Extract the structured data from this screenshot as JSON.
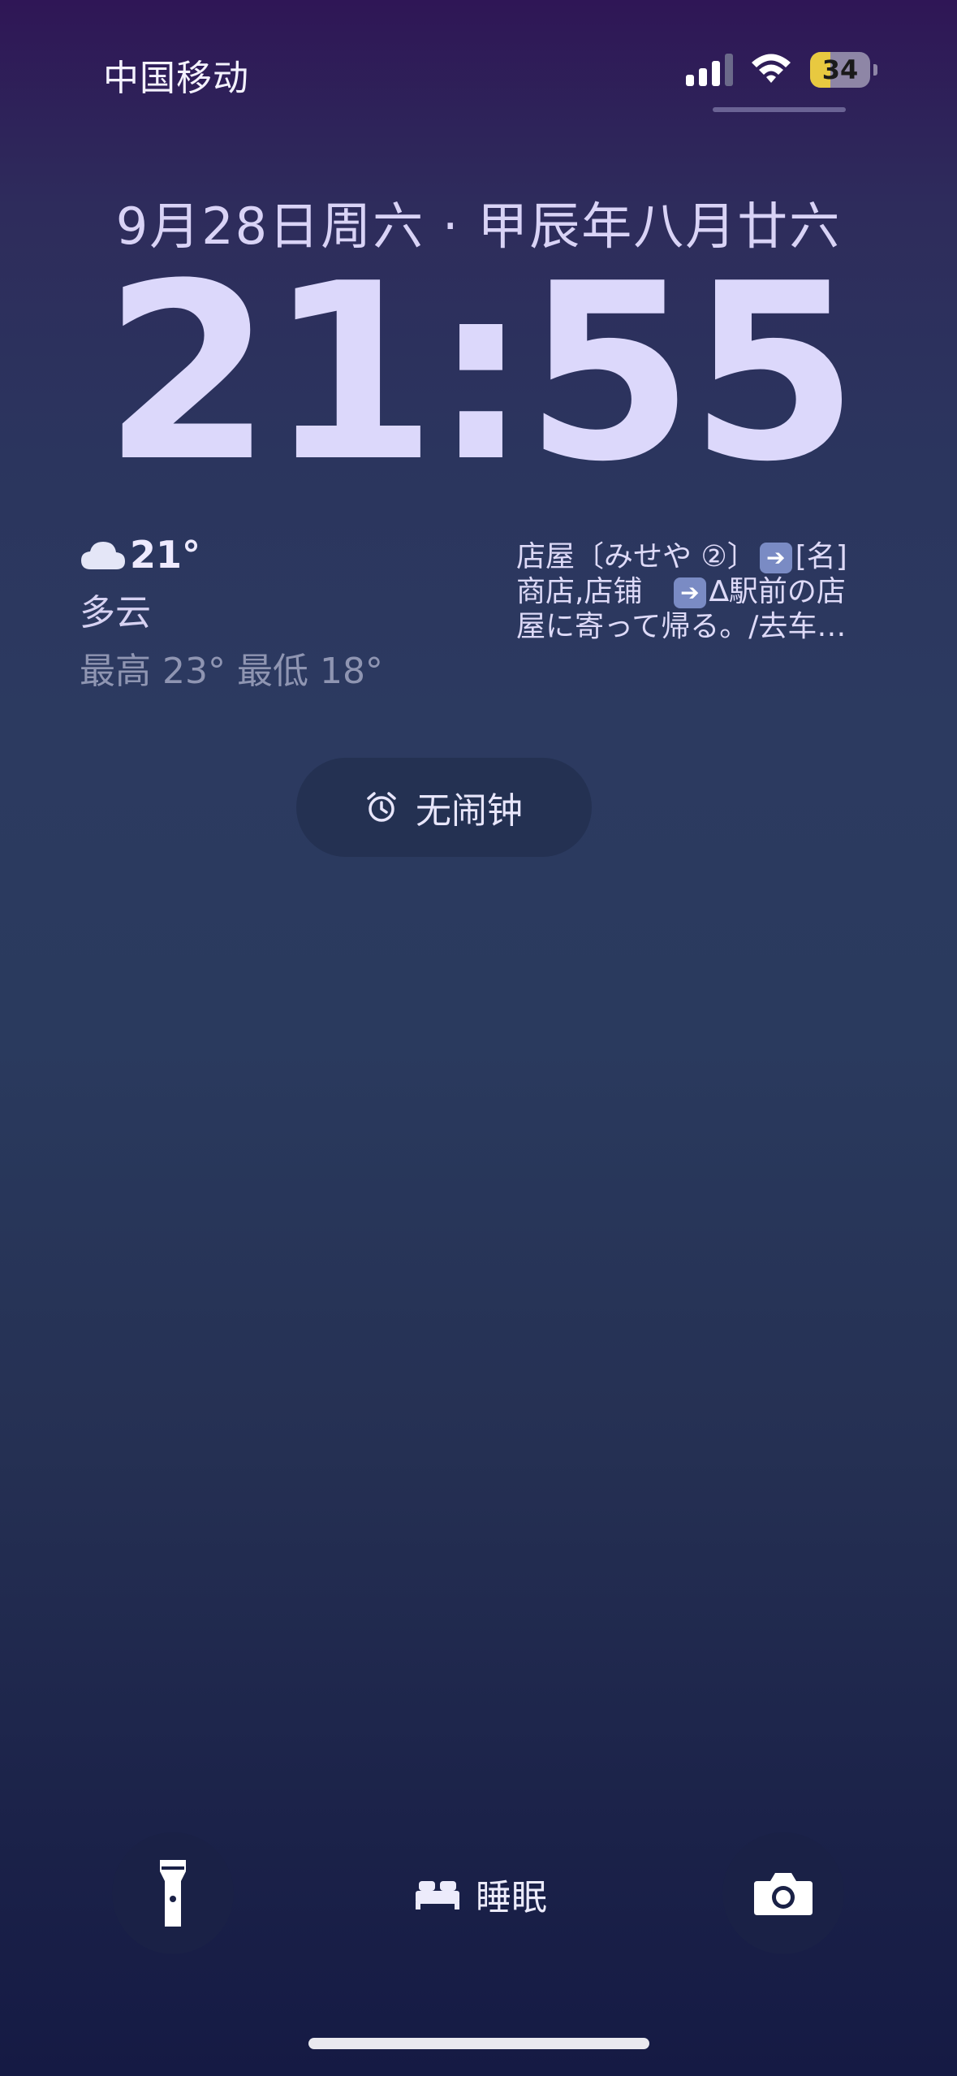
{
  "status_bar": {
    "carrier": "中国移动",
    "battery_level": "34",
    "battery_fraction": 0.34,
    "battery_color": "#e8c940"
  },
  "lock_screen": {
    "date": "9月28日周六 · 甲辰年八月廿六",
    "time": "21:55"
  },
  "weather": {
    "icon": "cloud-icon",
    "temperature": "21°",
    "condition": "多云",
    "range": "最高 23° 最低 18°"
  },
  "note_widget": {
    "line1_a": "店屋〔みせや ②〕",
    "line1_b": "[名]",
    "line2_a": "商店,店铺",
    "line2_b": "∆駅前の店",
    "line3": "屋に寄って帰る。/去车…"
  },
  "alarm": {
    "icon": "alarm-clock-icon",
    "label": "无闹钟"
  },
  "bottom": {
    "flashlight_icon": "flashlight-icon",
    "sleep_icon": "bed-icon",
    "sleep_label": "睡眠",
    "camera_icon": "camera-icon"
  }
}
